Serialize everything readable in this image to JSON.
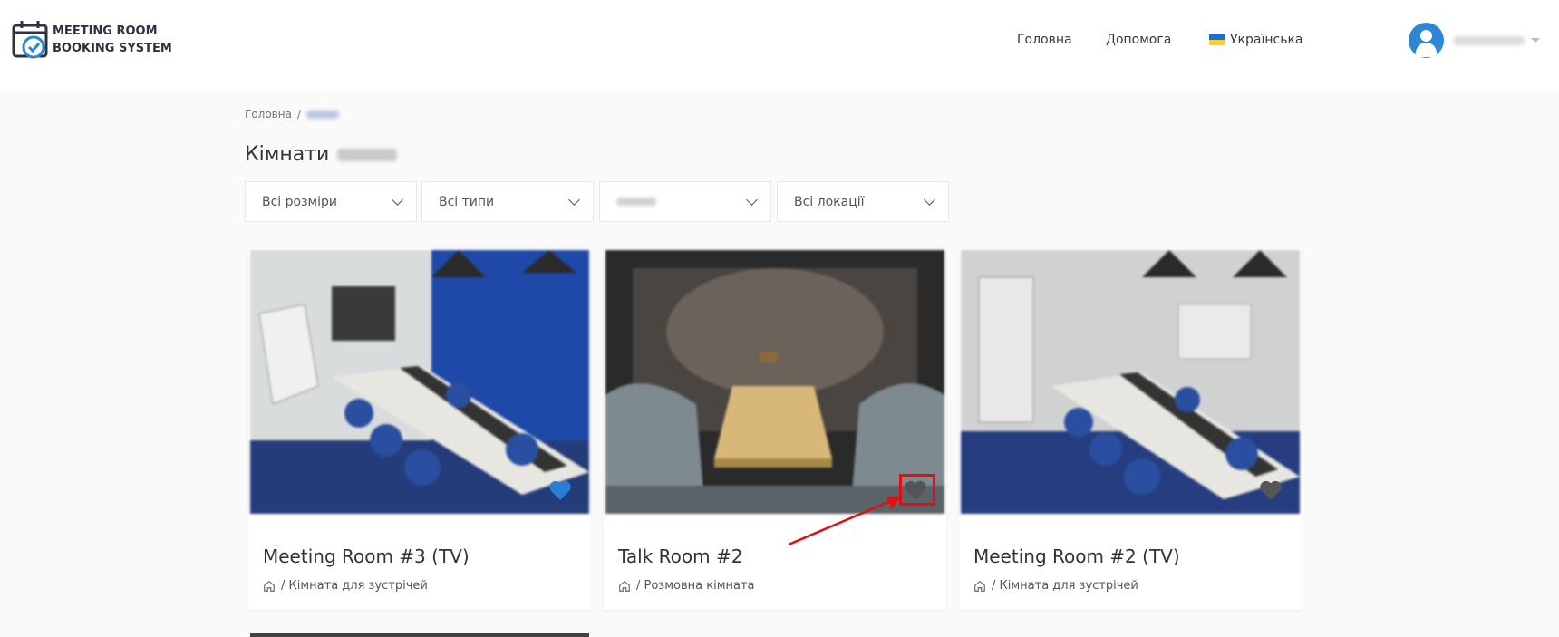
{
  "header": {
    "logo_line1": "MEETING ROOM",
    "logo_line2": "BOOKING SYSTEM",
    "nav_home": "Головна",
    "nav_help": "Допомога",
    "nav_lang": "Українська"
  },
  "breadcrumb": {
    "home": "Головна",
    "separator": "/"
  },
  "title": {
    "prefix": "Кімнати"
  },
  "filters": {
    "sizes": "Всі розміри",
    "types": "Всі типи",
    "locations": "Всі локації"
  },
  "cards": [
    {
      "title": "Meeting Room #3 (TV)",
      "sub": "/ Кімната для зустрічей",
      "favorite": true
    },
    {
      "title": "Talk Room #2",
      "sub": "/ Розмовна кімната",
      "favorite": false
    },
    {
      "title": "Meeting Room #2 (TV)",
      "sub": "/ Кімната для зустрічей",
      "favorite": false
    }
  ],
  "colors": {
    "favorite": "#2a7fd4",
    "not_favorite": "#555555",
    "accent": "#2e86d6",
    "annotation": "#e01010"
  }
}
